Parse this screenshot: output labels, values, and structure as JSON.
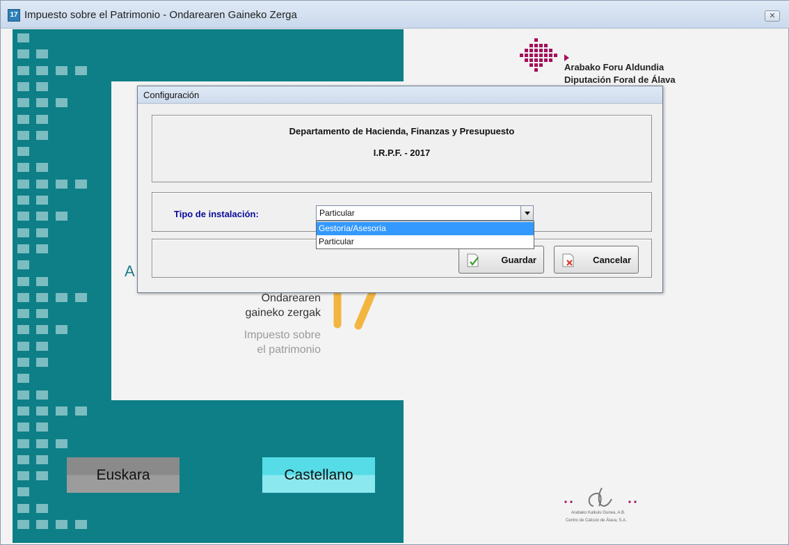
{
  "window": {
    "title": "Impuesto sobre el Patrimonio - Ondarearen Gaineko Zerga",
    "app_icon_text": "17",
    "close_label": "✕"
  },
  "splash": {
    "org_line1": "Arabako Foru Aldundia",
    "org_line2": "Diputación Foral de Álava",
    "partial_letter": "A",
    "eu_line1": "Ondarearen",
    "eu_line2": "gaineko zergak",
    "es_line1": "Impuesto sobre",
    "es_line2": "el patrimonio",
    "btn_euskara": "Euskara",
    "btn_castellano": "Castellano",
    "footer_line1": "Arabako Kalkulu Gunea, A.B.",
    "footer_line2": "Centro de Cálculo de Álava, S.A."
  },
  "dialog": {
    "title": "Configuración",
    "department": "Departamento de Hacienda, Finanzas y Presupuesto",
    "subtitle": "I.R.P.F. - 2017",
    "tipo_label": "Tipo de instalación:",
    "tipo_value": "Particular",
    "options": [
      "Gestoría/Asesoría",
      "Particular"
    ],
    "guardar": "Guardar",
    "cancelar": "Cancelar"
  },
  "colors": {
    "teal": "#0e7f86",
    "brand_magenta": "#a3105a",
    "selection": "#3399ff",
    "label_blue": "#0a0a9a",
    "orange": "#f2b640"
  }
}
